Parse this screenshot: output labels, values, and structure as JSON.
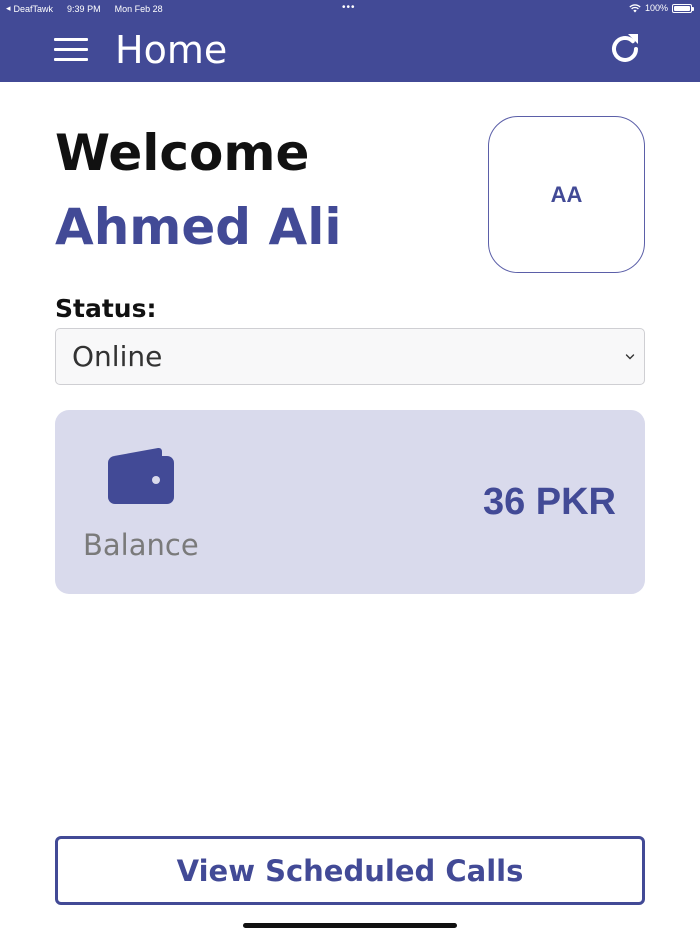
{
  "status_bar": {
    "back_app": "DeafTawk",
    "time": "9:39 PM",
    "date": "Mon Feb 28",
    "multitask_dots": "•••",
    "battery_text": "100%"
  },
  "app_bar": {
    "title": "Home",
    "menu_icon": "hamburger-menu-icon",
    "refresh_icon": "refresh-icon"
  },
  "welcome": {
    "greeting": "Welcome",
    "user_name": "Ahmed Ali",
    "avatar_initials": "AA"
  },
  "status": {
    "label": "Status:",
    "selected": "Online"
  },
  "balance": {
    "icon": "wallet-icon",
    "label": "Balance",
    "amount": "36 PKR"
  },
  "actions": {
    "view_scheduled_calls": "View Scheduled Calls"
  },
  "colors": {
    "primary": "#424a96",
    "card_background": "#d9daec",
    "text_dark": "#111111",
    "text_muted": "#7a7a7a"
  }
}
